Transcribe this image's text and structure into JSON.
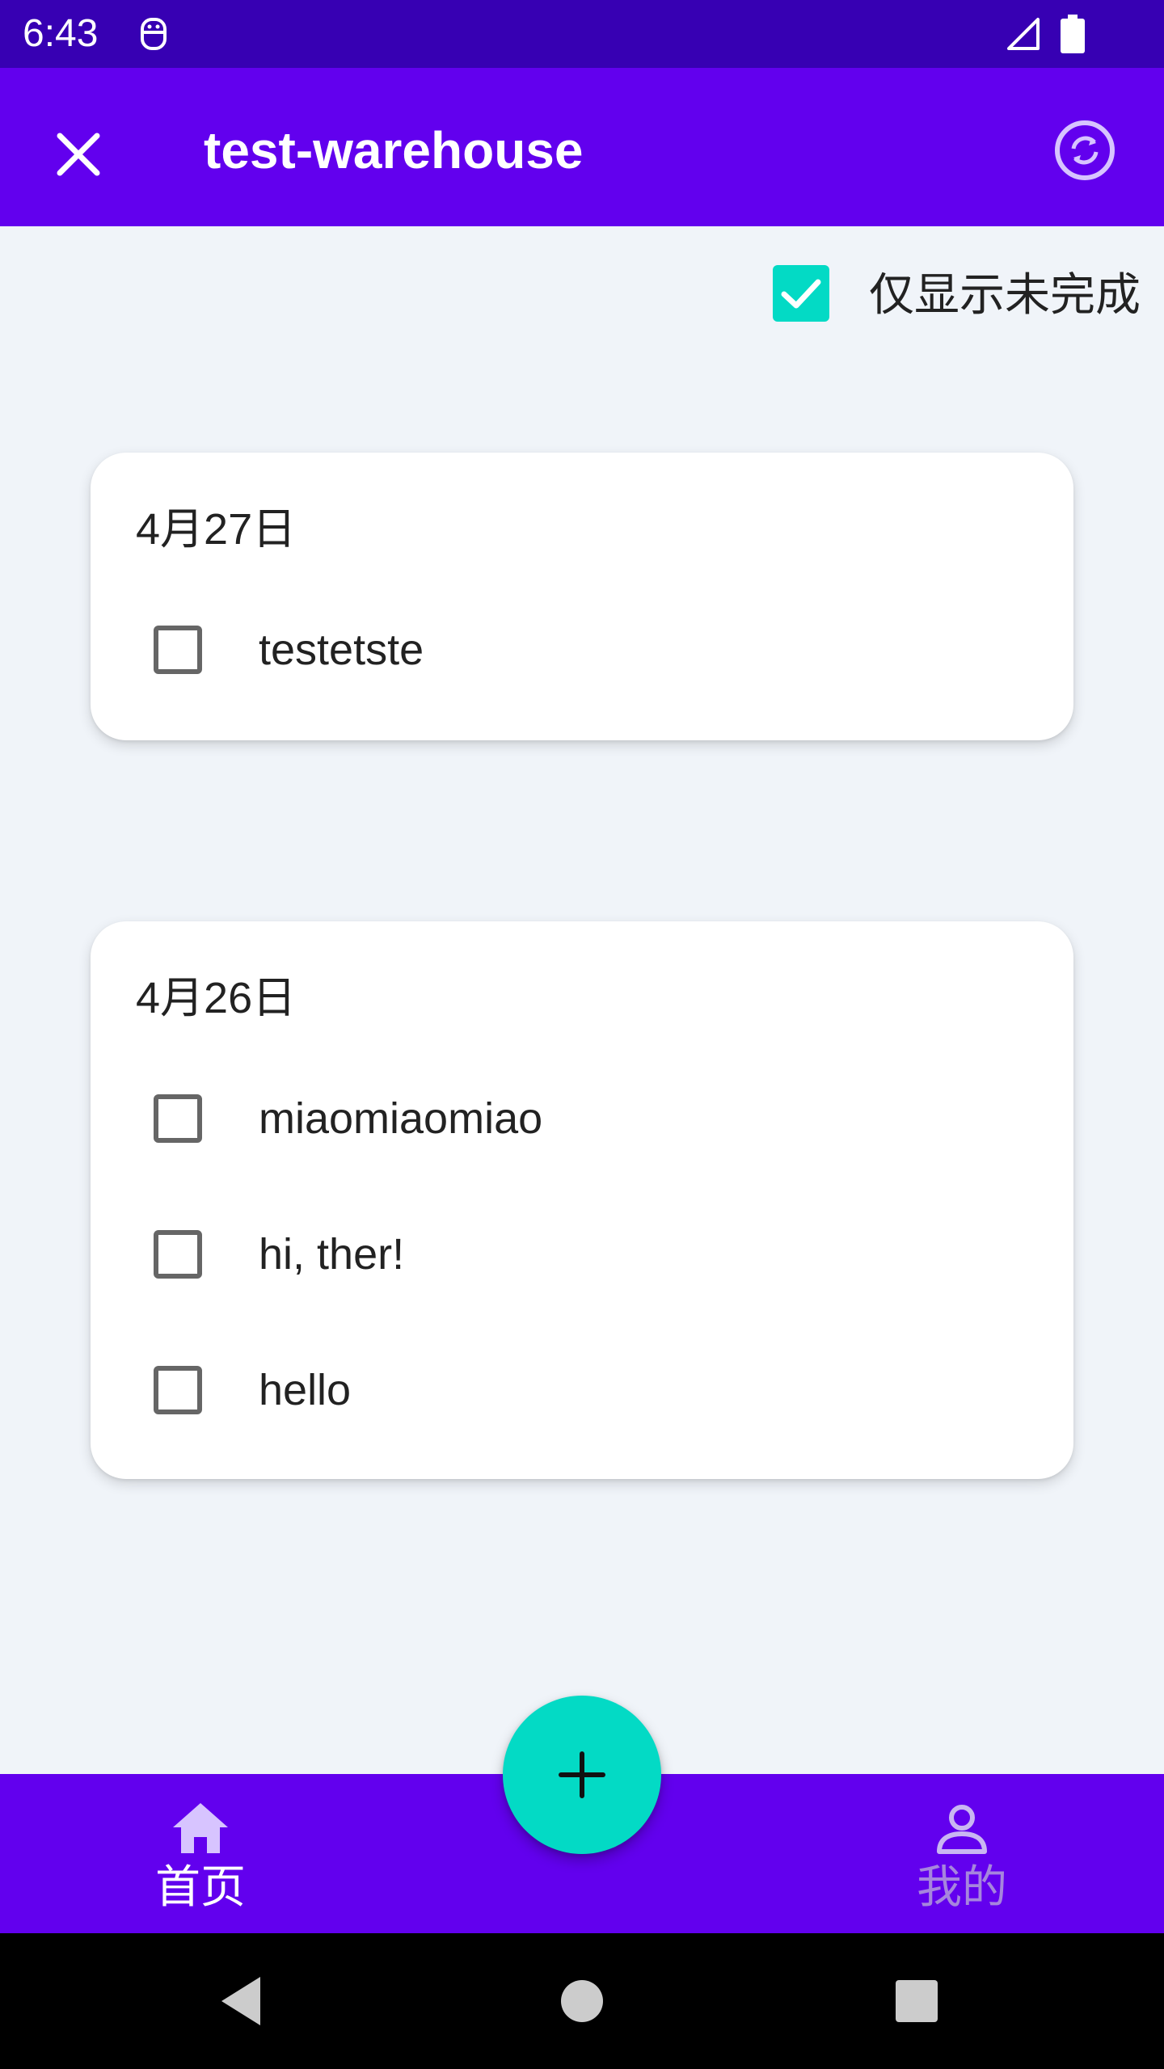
{
  "status_bar": {
    "time": "6:43",
    "icons": [
      "notification-icon",
      "cell-signal-icon",
      "battery-icon"
    ]
  },
  "app_bar": {
    "title": "test-warehouse",
    "close_icon": "close-icon",
    "sync_icon": "sync-icon",
    "color": "#6200ee"
  },
  "filter": {
    "label": "仅显示未完成",
    "checked": true,
    "accent": "#03dac5"
  },
  "groups": [
    {
      "date": "4月27日",
      "items": [
        {
          "text": "testetste",
          "checked": false
        }
      ]
    },
    {
      "date": "4月26日",
      "items": [
        {
          "text": "miaomiaomiao",
          "checked": false
        },
        {
          "text": "hi, ther!",
          "checked": false
        },
        {
          "text": "hello",
          "checked": false
        }
      ]
    }
  ],
  "fab": {
    "icon": "plus-icon"
  },
  "bottom_nav": {
    "items": [
      {
        "label": "首页",
        "icon": "home-icon",
        "active": true
      },
      {
        "label": "我的",
        "icon": "person-icon",
        "active": false
      }
    ]
  },
  "system_nav": {
    "icons": [
      "back-icon",
      "home-circle-icon",
      "recents-icon"
    ]
  }
}
